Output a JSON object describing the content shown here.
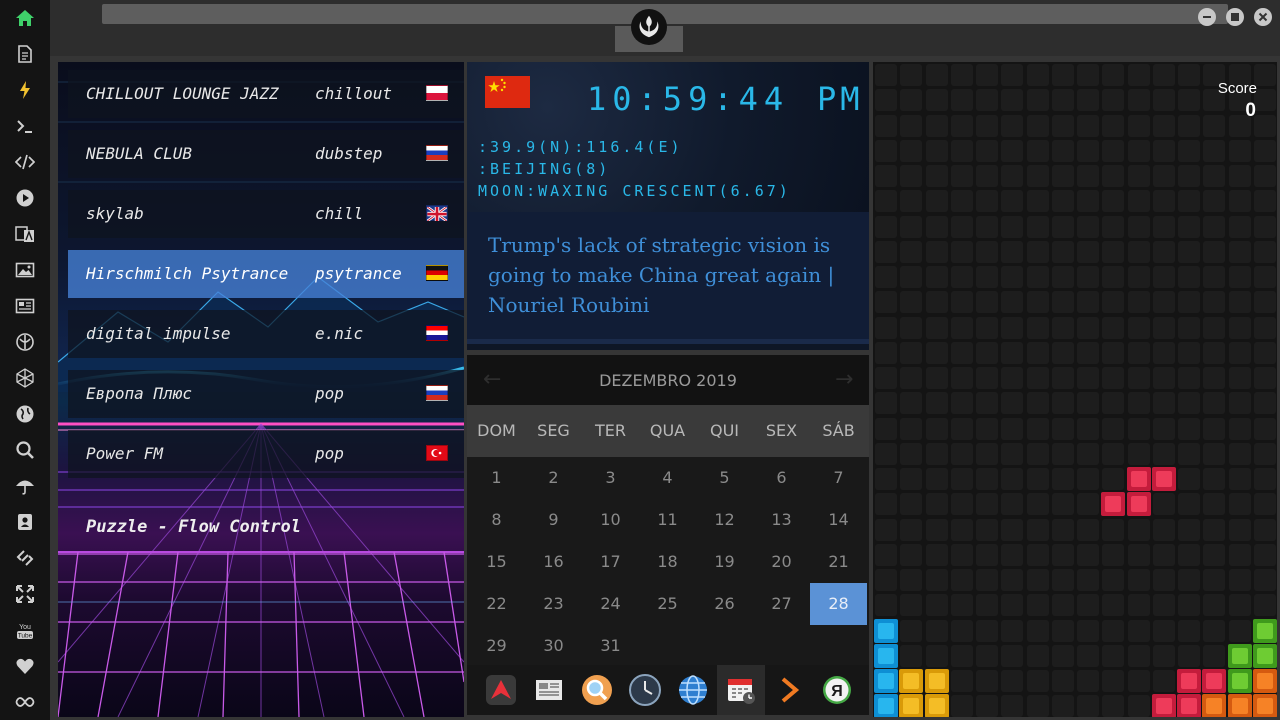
{
  "sidebar": {
    "accent_color": "#3fd16a",
    "icons": [
      "home-icon",
      "document-icon",
      "lightning-icon",
      "terminal-icon",
      "code-icon",
      "play-icon",
      "translate-icon",
      "image-icon",
      "news-icon",
      "rebel-alliance-icon",
      "geometry-icon",
      "globe-icon",
      "search-icon",
      "umbrella-icon",
      "contact-icon",
      "link-icon",
      "expand-icon",
      "youtube-icon",
      "heart-icon",
      "infinity-icon"
    ]
  },
  "window": {
    "emblem": "rebel-alliance-emblem"
  },
  "radio": {
    "stations": [
      {
        "name": "CHILLOUT LOUNGE JAZZ",
        "genre": "chillout",
        "flag": "poland"
      },
      {
        "name": "NEBULA CLUB",
        "genre": "dubstep",
        "flag": "russia"
      },
      {
        "name": "skylab",
        "genre": "chill",
        "flag": "united-kingdom"
      },
      {
        "name": "Hirschmilch Psytrance",
        "genre": "psytrance",
        "flag": "germany"
      },
      {
        "name": "digital impulse",
        "genre": "e.nic",
        "flag": "croatia"
      },
      {
        "name": "Европа Плюс",
        "genre": "pop",
        "flag": "russia"
      },
      {
        "name": "Power FM",
        "genre": "pop",
        "flag": "turkey"
      }
    ],
    "active_index": 3,
    "now_playing": "Puzzle - Flow Control"
  },
  "clock": {
    "flag": "china",
    "time": "10:59:44",
    "ampm": "PM",
    "coords": ":39.9(N):116.4(E)",
    "location": ":BEIJING(8)",
    "moon": "MOON:WAXING CRESCENT(6.67)",
    "headline": "Trump's lack of strategic vision is going to make China great again | Nouriel Roubini"
  },
  "calendar": {
    "month_label": "DEZEMBRO 2019",
    "prev_arrow": "←",
    "next_arrow": "→",
    "weekdays": [
      "DOM",
      "SEG",
      "TER",
      "QUA",
      "QUI",
      "SEX",
      "SÁB"
    ],
    "days": [
      "1",
      "2",
      "3",
      "4",
      "5",
      "6",
      "7",
      "8",
      "9",
      "10",
      "11",
      "12",
      "13",
      "14",
      "15",
      "16",
      "17",
      "18",
      "19",
      "20",
      "21",
      "22",
      "23",
      "24",
      "25",
      "26",
      "27",
      "28",
      "29",
      "30",
      "31"
    ],
    "selected_day": 28
  },
  "dock": {
    "apps": [
      "arch-icon",
      "news-reader-icon",
      "magnifier-icon",
      "clock-icon",
      "globe-icon",
      "calendar-icon",
      "play-arrow-icon",
      "yandex-icon"
    ],
    "active_index": 5
  },
  "tetris": {
    "score_label": "Score",
    "score": "0",
    "colors": {
      "cyan": "#28b6ee",
      "yellow": "#f4bd26",
      "red": "#ee3b5a",
      "green": "#6ecc33",
      "orange": "#f68226"
    }
  }
}
